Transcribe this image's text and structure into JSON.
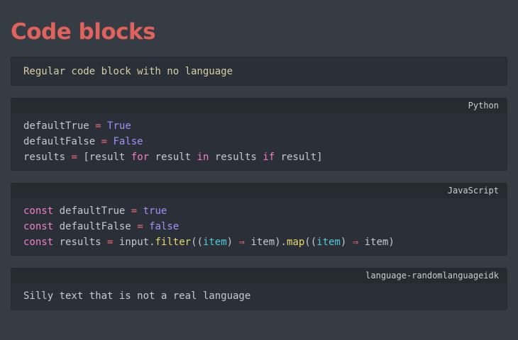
{
  "page": {
    "heading": "Code blocks"
  },
  "blocks": {
    "plain": {
      "line": "Regular code block with no language"
    },
    "python": {
      "language": "Python",
      "line1": {
        "name": "defaultTrue",
        "op": "=",
        "value": "True"
      },
      "line2": {
        "name": "defaultFalse",
        "op": "=",
        "value": "False"
      },
      "line3": {
        "name": "results",
        "op": "=",
        "open": "[result",
        "kw_for": "for",
        "mid1": "result",
        "kw_in": "in",
        "mid2": "results",
        "kw_if": "if",
        "close": "result]"
      }
    },
    "javascript": {
      "language": "JavaScript",
      "line1": {
        "kw": "const",
        "name": "defaultTrue",
        "op": "=",
        "value": "true"
      },
      "line2": {
        "kw": "const",
        "name": "defaultFalse",
        "op": "=",
        "value": "false"
      },
      "line3": {
        "kw": "const",
        "name": "results",
        "op": "=",
        "obj": "input.",
        "fn1": "filter",
        "p1": "((",
        "param1": "item",
        "p2": ")",
        "arrow1": "⇒",
        "body1": "item).",
        "fn2": "map",
        "p3": "((",
        "param2": "item",
        "p4": ")",
        "arrow2": "⇒",
        "body2": "item)"
      }
    },
    "unknown": {
      "language": "language-randomlanguageidk",
      "line": "Silly text that is not a real language"
    }
  },
  "colors": {
    "background": "#363c44",
    "block_background": "#2b3038",
    "heading": "#e0625d",
    "keyword": "#f27ec7",
    "operator": "#ef6a74",
    "boolean": "#a68ef7",
    "function": "#e9d96e",
    "parameter": "#52c8d7"
  }
}
